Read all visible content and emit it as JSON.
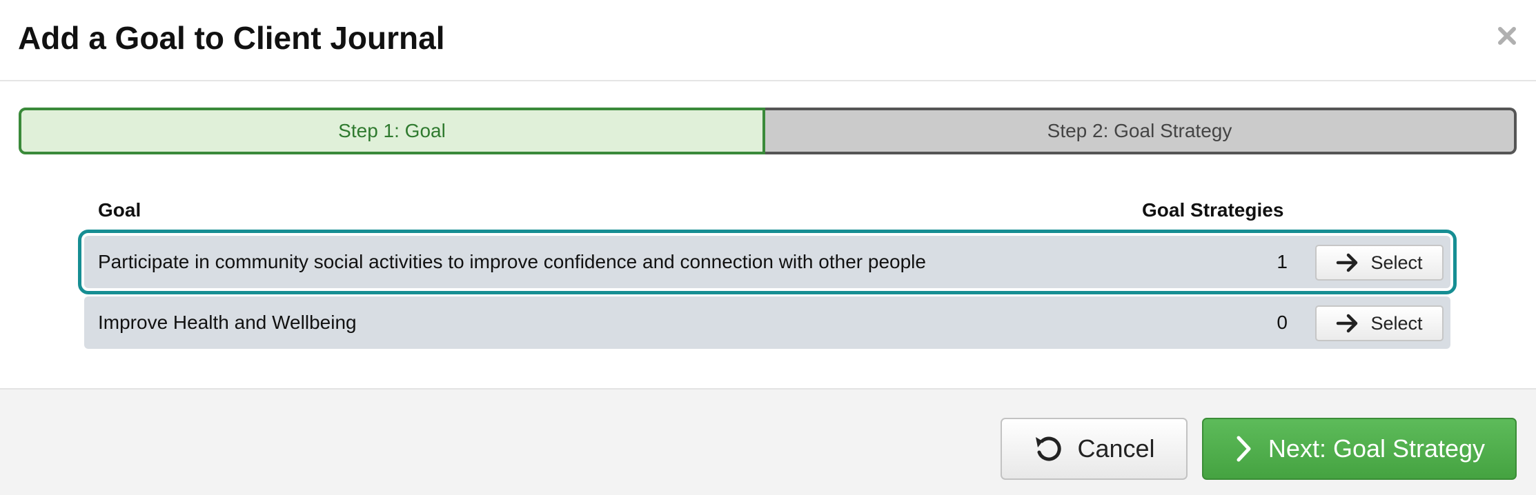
{
  "modal": {
    "title": "Add a Goal to Client Journal",
    "close_icon": "close-icon"
  },
  "stepper": {
    "steps": [
      {
        "label": "Step 1: Goal",
        "state": "active",
        "color": "#3a8a3a"
      },
      {
        "label": "Step 2: Goal Strategy",
        "state": "inactive",
        "color": "#555555"
      }
    ]
  },
  "table": {
    "columns": {
      "goal": "Goal",
      "strategies": "Goal Strategies"
    },
    "rows": [
      {
        "goal": "Participate in community social activities to improve confidence and connection with other people",
        "strategies": "1",
        "action": "Select",
        "action_icon": "arrow-right-icon",
        "selected": true
      },
      {
        "goal": "Improve Health and Wellbeing",
        "strategies": "0",
        "action": "Select",
        "action_icon": "arrow-right-icon",
        "selected": false
      }
    ]
  },
  "footer": {
    "cancel_label": "Cancel",
    "cancel_icon": "undo-icon",
    "next_label": "Next: Goal Strategy",
    "next_icon": "chevron-right-icon"
  },
  "colors": {
    "primary_green": "#4cae4c",
    "selection_outline": "#168e93",
    "row_background": "#d8dde3"
  }
}
